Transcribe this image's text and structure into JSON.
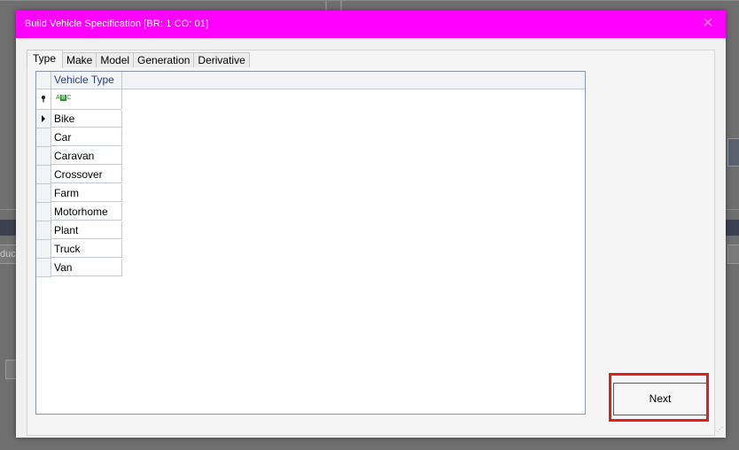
{
  "window": {
    "title": "Build Vehicle Specification [BR: 1 CO: 01]",
    "close_label": "✕"
  },
  "tabs": [
    {
      "label": "Type",
      "active": true
    },
    {
      "label": "Make"
    },
    {
      "label": "Model"
    },
    {
      "label": "Generation"
    },
    {
      "label": "Derivative"
    }
  ],
  "grid": {
    "column_header": "Vehicle Type",
    "filter_icon": "abc-filter-icon",
    "rows": [
      "Bike",
      "Car",
      "Caravan",
      "Crossover",
      "Farm",
      "Motorhome",
      "Plant",
      "Truck",
      "Van"
    ],
    "selected_row": 0
  },
  "actions": {
    "next_label": "Next"
  },
  "background": {
    "partial_text": "duc"
  },
  "colors": {
    "titlebar": "#ff00ff",
    "highlight": "#e11d1d",
    "header_text": "#2c3e78"
  }
}
